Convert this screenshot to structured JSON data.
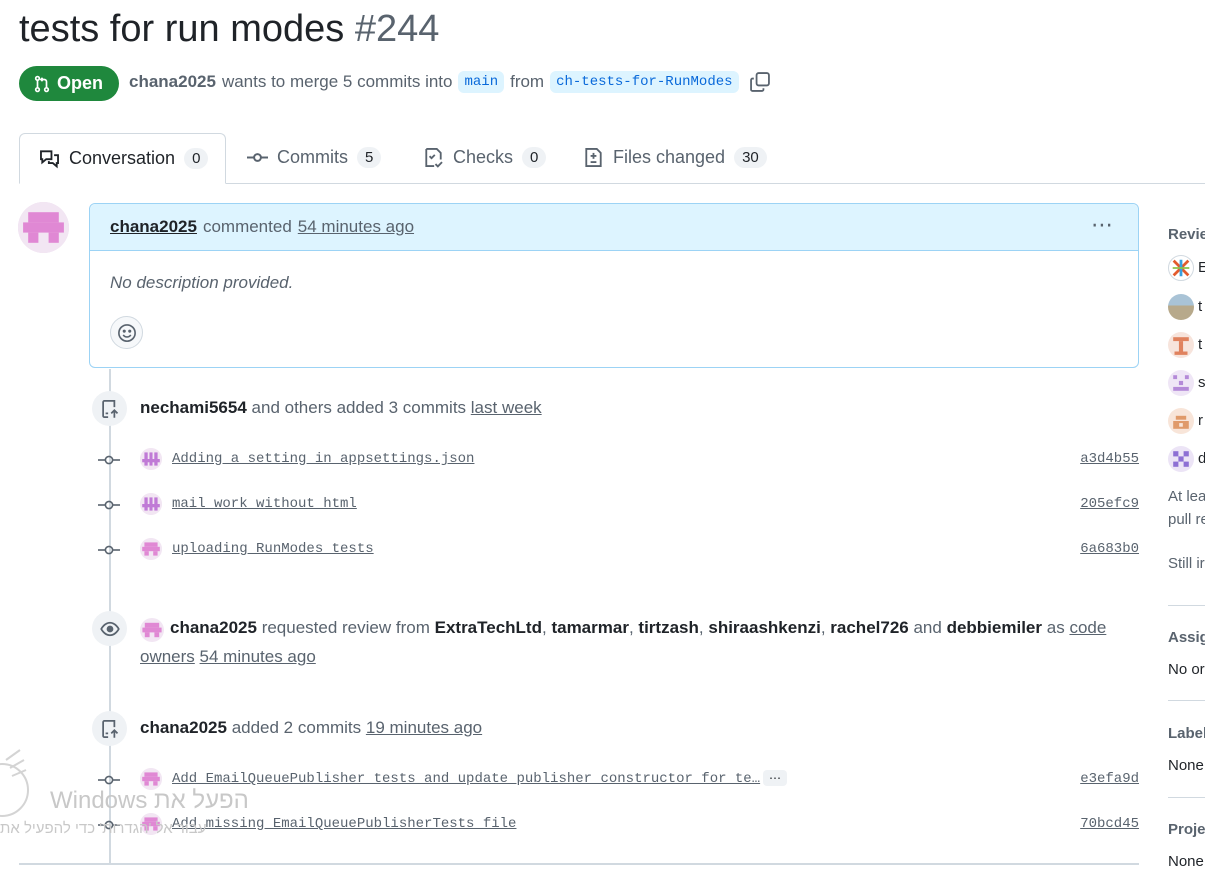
{
  "pr": {
    "title": "tests for run modes",
    "number": "#244",
    "state": "Open",
    "author": "chana2025",
    "merge_text": "wants to merge 5 commits into",
    "base_branch": "main",
    "from_text": "from",
    "head_branch": "ch-tests-for-RunModes"
  },
  "tabs": [
    {
      "label": "Conversation",
      "count": "0",
      "icon": "comment-discussion-icon"
    },
    {
      "label": "Commits",
      "count": "5",
      "icon": "git-commit-icon"
    },
    {
      "label": "Checks",
      "count": "0",
      "icon": "checklist-icon"
    },
    {
      "label": "Files changed",
      "count": "30",
      "icon": "file-diff-icon"
    }
  ],
  "comment": {
    "author": "chana2025",
    "action": "commented",
    "time": "54 minutes ago",
    "body": "No description provided."
  },
  "event1": {
    "author": "nechami5654",
    "text": "and others added 3 commits",
    "time": "last week"
  },
  "commits_group1": [
    {
      "message": "Adding a setting in appsettings.json",
      "sha": "a3d4b55"
    },
    {
      "message": "mail work without html",
      "sha": "205efc9"
    },
    {
      "message": "uploading RunModes tests",
      "sha": "6a683b0"
    }
  ],
  "review_event": {
    "author": "chana2025",
    "text": "requested review from",
    "reviewers": [
      "ExtraTechLtd",
      "tamarmar",
      "tirtzash",
      "shiraashkenzi",
      "rachel726"
    ],
    "and_text": "and",
    "last_reviewer": "debbiemiler",
    "as_text": "as",
    "link1": "code",
    "link2": "owners",
    "time": "54 minutes ago"
  },
  "event2": {
    "author": "chana2025",
    "text": "added 2 commits",
    "time": "19 minutes ago"
  },
  "commits_group2": [
    {
      "message": "Add EmailQueuePublisher tests and update publisher constructor for te…",
      "sha": "e3efa9d",
      "more": "⋯"
    },
    {
      "message": "Add missing EmailQueuePublisherTests file",
      "sha": "70bcd45"
    }
  ],
  "sidebar": {
    "reviewers_label": "Revie",
    "reviewer_initials": [
      "E",
      "t",
      "t",
      "s",
      "r",
      "d"
    ],
    "note_line1": "At lea",
    "note_line2": "pull re",
    "note_line3": "Still ir",
    "assignees_label": "Assig",
    "assignees_value": "No or",
    "labels_label": "Label",
    "labels_value": "None",
    "projects_label": "Proje",
    "projects_value": "None"
  },
  "watermark": {
    "line1": "Windows הפעל את",
    "line2": "עבור אל 'הגדרות' כדי להפעיל את"
  },
  "colors": {
    "open_green": "#1f883d",
    "accent_blue": "#0969da",
    "comment_header": "#ddf4ff"
  }
}
